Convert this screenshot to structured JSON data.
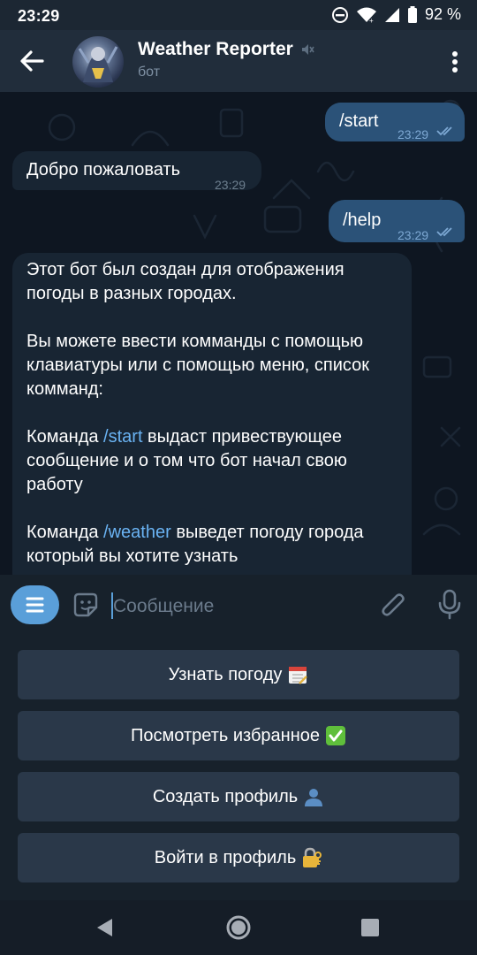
{
  "status_bar": {
    "time": "23:29",
    "battery": "92 %"
  },
  "app_bar": {
    "title": "Weather Reporter",
    "subtitle": "бот"
  },
  "messages": {
    "m1": {
      "text": "/start",
      "time": "23:29"
    },
    "m2": {
      "text": "Добро пожаловать",
      "time": "23:29"
    },
    "m3": {
      "text": "/help",
      "time": "23:29"
    },
    "m4": {
      "p1": "Этот бот был создан для отображения погоды в разных городах.",
      "p2": "Вы можете ввести комманды с помощью клавиатуры или с помощью меню, список комманд:",
      "p3_pre": "Команда ",
      "p3_link": "/start",
      "p3_post": " выдаст привествующее сообщение и о том что бот начал свою работу",
      "p4_pre": "Команда ",
      "p4_link": "/weather",
      "p4_post": " выведет погоду города который вы хотите узнать"
    }
  },
  "input": {
    "placeholder": "Сообщение"
  },
  "keyboard": {
    "buttons": [
      {
        "label": "Узнать погоду",
        "emoji": "calendar-emoji"
      },
      {
        "label": "Посмотреть избранное",
        "emoji": "check-mark-emoji"
      },
      {
        "label": "Создать профиль",
        "emoji": "bust-silhouette-emoji"
      },
      {
        "label": "Войти в профиль",
        "emoji": "locked-with-key-emoji"
      }
    ]
  },
  "colors": {
    "outgoing_bubble": "#2b5278",
    "incoming_bubble": "#182533",
    "chat_bg": "#0e1621",
    "accent": "#5a9fd9",
    "link": "#6ab3f3",
    "keyboard_button": "#2a3849"
  }
}
